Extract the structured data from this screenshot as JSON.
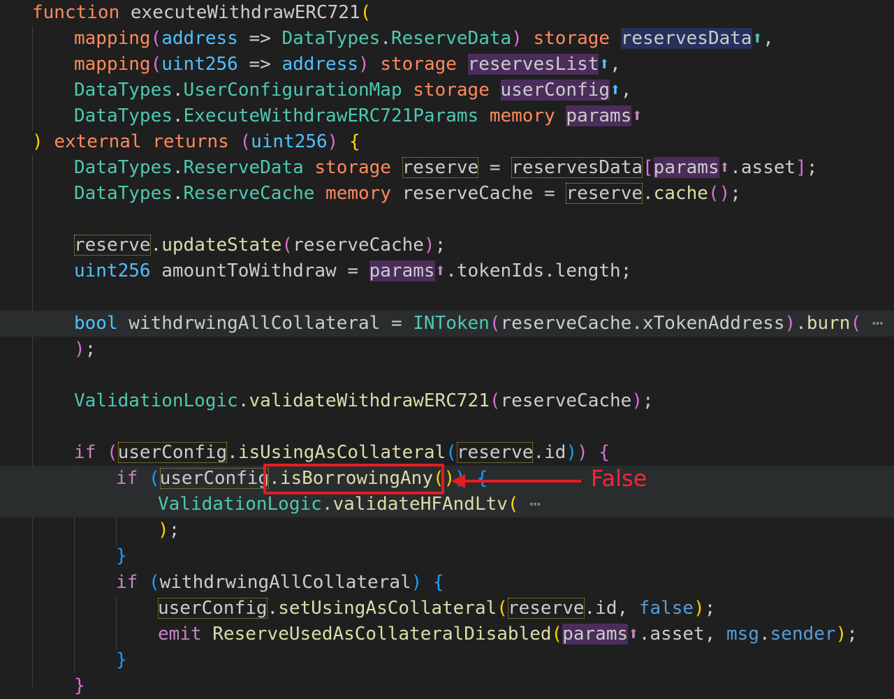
{
  "editor": {
    "lines": [
      {
        "tokens": [
          [
            "kw",
            "function"
          ],
          [
            "ident",
            " executeWithdrawERC721"
          ],
          [
            "br1",
            "("
          ]
        ]
      },
      {
        "tokens": [
          [
            "kw",
            "mapping"
          ],
          [
            "br2",
            "("
          ],
          [
            "ty",
            "address"
          ],
          [
            "ident",
            " => "
          ],
          [
            "cls",
            "DataTypes"
          ],
          [
            "ident",
            "."
          ],
          [
            "cls",
            "ReserveData"
          ],
          [
            "br2",
            ")"
          ],
          [
            "ident",
            " "
          ],
          [
            "kw",
            "storage"
          ],
          [
            "ident",
            " "
          ],
          [
            "hl-blue",
            "reservesData"
          ],
          [
            "up-arrow green",
            "⬆"
          ],
          [
            "ident",
            ","
          ]
        ]
      },
      {
        "tokens": [
          [
            "kw",
            "mapping"
          ],
          [
            "br2",
            "("
          ],
          [
            "ty",
            "uint256"
          ],
          [
            "ident",
            " => "
          ],
          [
            "ty",
            "address"
          ],
          [
            "br2",
            ")"
          ],
          [
            "ident",
            " "
          ],
          [
            "kw",
            "storage"
          ],
          [
            "ident",
            " "
          ],
          [
            "hl-purple",
            "reservesList"
          ],
          [
            "up-arrow",
            "⬆"
          ],
          [
            "ident",
            ","
          ]
        ]
      },
      {
        "tokens": [
          [
            "cls",
            "DataTypes"
          ],
          [
            "ident",
            "."
          ],
          [
            "cls",
            "UserConfigurationMap"
          ],
          [
            "ident",
            " "
          ],
          [
            "kw",
            "storage"
          ],
          [
            "ident",
            " "
          ],
          [
            "hl-purple",
            "userConfig"
          ],
          [
            "up-arrow",
            "⬆"
          ],
          [
            "ident",
            ","
          ]
        ]
      },
      {
        "tokens": [
          [
            "cls",
            "DataTypes"
          ],
          [
            "ident",
            "."
          ],
          [
            "cls",
            "ExecuteWithdrawERC721Params"
          ],
          [
            "ident",
            " "
          ],
          [
            "kw",
            "memory"
          ],
          [
            "ident",
            " "
          ],
          [
            "hl-purple",
            "params"
          ],
          [
            "up-arrow pink",
            "⬆"
          ]
        ]
      },
      {
        "tokens": [
          [
            "br1",
            ")"
          ],
          [
            "ident",
            " "
          ],
          [
            "kw",
            "external"
          ],
          [
            "ident",
            " "
          ],
          [
            "kw",
            "returns"
          ],
          [
            "ident",
            " "
          ],
          [
            "br2",
            "("
          ],
          [
            "ty",
            "uint256"
          ],
          [
            "br2",
            ")"
          ],
          [
            "ident",
            " "
          ],
          [
            "br1",
            "{"
          ]
        ]
      },
      {
        "tokens": [
          [
            "cls",
            "DataTypes"
          ],
          [
            "ident",
            "."
          ],
          [
            "cls",
            "ReserveData"
          ],
          [
            "ident",
            " "
          ],
          [
            "kw",
            "storage"
          ],
          [
            "ident",
            " "
          ],
          [
            "box",
            "reserve"
          ],
          [
            "ident",
            " = "
          ],
          [
            "box",
            "reservesData"
          ],
          [
            "br2",
            "["
          ],
          [
            "hl-purple",
            "params"
          ],
          [
            "up-arrow pink",
            "⬆"
          ],
          [
            "ident",
            ".asset"
          ],
          [
            "br2",
            "]"
          ],
          [
            "ident",
            ";"
          ]
        ]
      },
      {
        "tokens": [
          [
            "cls",
            "DataTypes"
          ],
          [
            "ident",
            "."
          ],
          [
            "cls",
            "ReserveCache"
          ],
          [
            "ident",
            " "
          ],
          [
            "kw",
            "memory"
          ],
          [
            "ident",
            " reserveCache = "
          ],
          [
            "box",
            "reserve"
          ],
          [
            "ident",
            "."
          ],
          [
            "fn",
            "cache"
          ],
          [
            "br2",
            "()"
          ],
          [
            "ident",
            ";"
          ]
        ]
      },
      {
        "tokens": []
      },
      {
        "tokens": [
          [
            "box",
            "reserve"
          ],
          [
            "ident",
            "."
          ],
          [
            "fn",
            "updateState"
          ],
          [
            "br2",
            "("
          ],
          [
            "ident",
            "reserveCache"
          ],
          [
            "br2",
            ")"
          ],
          [
            "ident",
            ";"
          ]
        ]
      },
      {
        "tokens": [
          [
            "ty",
            "uint256"
          ],
          [
            "ident",
            " amountToWithdraw = "
          ],
          [
            "hl-purple",
            "params"
          ],
          [
            "up-arrow pink",
            "⬆"
          ],
          [
            "ident",
            ".tokenIds.length;"
          ]
        ]
      },
      {
        "tokens": []
      },
      {
        "tokens": [
          [
            "ty",
            "bool"
          ],
          [
            "ident",
            " withdrwingAllCollateral = "
          ],
          [
            "cls",
            "INToken"
          ],
          [
            "br2",
            "("
          ],
          [
            "ident",
            "reserveCache.xTokenAddress"
          ],
          [
            "br2",
            ")"
          ],
          [
            "ident",
            "."
          ],
          [
            "fn",
            "burn"
          ],
          [
            "br2",
            "("
          ],
          [
            "ellipsis",
            " ⋯"
          ]
        ]
      },
      {
        "tokens": [
          [
            "br2",
            ")"
          ],
          [
            "ident",
            ";"
          ]
        ]
      },
      {
        "tokens": []
      },
      {
        "tokens": [
          [
            "cls",
            "ValidationLogic"
          ],
          [
            "ident",
            "."
          ],
          [
            "fn",
            "validateWithdrawERC721"
          ],
          [
            "br2",
            "("
          ],
          [
            "ident",
            "reserveCache"
          ],
          [
            "br2",
            ")"
          ],
          [
            "ident",
            ";"
          ]
        ]
      },
      {
        "tokens": []
      },
      {
        "tokens": [
          [
            "ctl",
            "if"
          ],
          [
            "ident",
            " "
          ],
          [
            "br2",
            "("
          ],
          [
            "box",
            "userConfig"
          ],
          [
            "ident",
            "."
          ],
          [
            "fn",
            "isUsingAsCollateral"
          ],
          [
            "br3",
            "("
          ],
          [
            "box",
            "reserve"
          ],
          [
            "ident",
            ".id"
          ],
          [
            "br3",
            ")"
          ],
          [
            "br2",
            ")"
          ],
          [
            "ident",
            " "
          ],
          [
            "br2",
            "{"
          ]
        ]
      },
      {
        "tokens": [
          [
            "ctl",
            "if"
          ],
          [
            "ident",
            " "
          ],
          [
            "br3",
            "("
          ],
          [
            "box",
            "userConfig"
          ],
          [
            "ident",
            "."
          ],
          [
            "fn",
            "isBorrowingAny"
          ],
          [
            "br1",
            "()"
          ],
          [
            "br3",
            ")"
          ],
          [
            "ident",
            " "
          ],
          [
            "br3",
            "{"
          ]
        ]
      },
      {
        "tokens": [
          [
            "cls",
            "ValidationLogic"
          ],
          [
            "ident",
            "."
          ],
          [
            "fn",
            "validateHFAndLtv"
          ],
          [
            "br1",
            "("
          ],
          [
            "ellipsis",
            " ⋯"
          ]
        ]
      },
      {
        "tokens": [
          [
            "br1",
            ")"
          ],
          [
            "ident",
            ";"
          ]
        ]
      },
      {
        "tokens": [
          [
            "br3",
            "}"
          ]
        ]
      },
      {
        "tokens": [
          [
            "ctl",
            "if"
          ],
          [
            "ident",
            " "
          ],
          [
            "br3",
            "("
          ],
          [
            "ident",
            "withdrwingAllCollateral"
          ],
          [
            "br3",
            ")"
          ],
          [
            "ident",
            " "
          ],
          [
            "br3",
            "{"
          ]
        ]
      },
      {
        "tokens": [
          [
            "box",
            "userConfig"
          ],
          [
            "ident",
            "."
          ],
          [
            "fn",
            "setUsingAsCollateral"
          ],
          [
            "br1",
            "("
          ],
          [
            "box",
            "reserve"
          ],
          [
            "ident",
            ".id, "
          ],
          [
            "bool",
            "false"
          ],
          [
            "br1",
            ")"
          ],
          [
            "ident",
            ";"
          ]
        ]
      },
      {
        "tokens": [
          [
            "ctl",
            "emit"
          ],
          [
            "ident",
            " "
          ],
          [
            "fn",
            "ReserveUsedAsCollateralDisabled"
          ],
          [
            "br1",
            "("
          ],
          [
            "hl-purple",
            "params"
          ],
          [
            "up-arrow pink",
            "⬆"
          ],
          [
            "ident",
            ".asset, "
          ],
          [
            "bool",
            "msg"
          ],
          [
            "ident",
            "."
          ],
          [
            "bool",
            "sender"
          ],
          [
            "br1",
            ")"
          ],
          [
            "ident",
            ";"
          ]
        ]
      },
      {
        "tokens": [
          [
            "br3",
            "}"
          ]
        ]
      },
      {
        "tokens": [
          [
            "br2",
            "}"
          ]
        ]
      }
    ]
  },
  "annotation": {
    "label": "False",
    "color": "#e51c23"
  }
}
